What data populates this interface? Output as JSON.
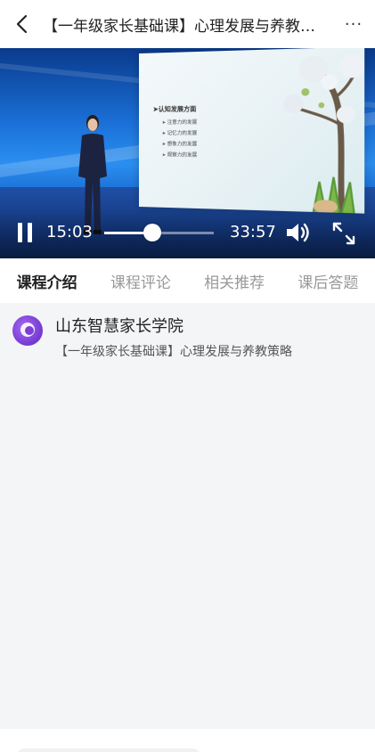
{
  "header": {
    "title": "【一年级家长基础课】心理发展与养教策略",
    "back_icon": "chevron-left-icon",
    "more_label": "···"
  },
  "video": {
    "slide": {
      "heading": "认知发展方面",
      "items": [
        "注意力的发展",
        "记忆力的发展",
        "想象力的发展",
        "观察力的发展"
      ]
    },
    "current_time": "15:03",
    "total_time": "33:57",
    "progress": 0.443,
    "state": "playing"
  },
  "tabs": [
    {
      "label": "课程介绍",
      "active": true
    },
    {
      "label": "课程评论",
      "active": false
    },
    {
      "label": "相关推荐",
      "active": false
    },
    {
      "label": "课后答题",
      "active": false
    }
  ],
  "course": {
    "org_name": "山东智慧家长学院",
    "course_title": "【一年级家长基础课】心理发展与养教策略"
  },
  "colors": {
    "accent": "#7b3fd6",
    "video_bg": "#1a6fd6"
  }
}
